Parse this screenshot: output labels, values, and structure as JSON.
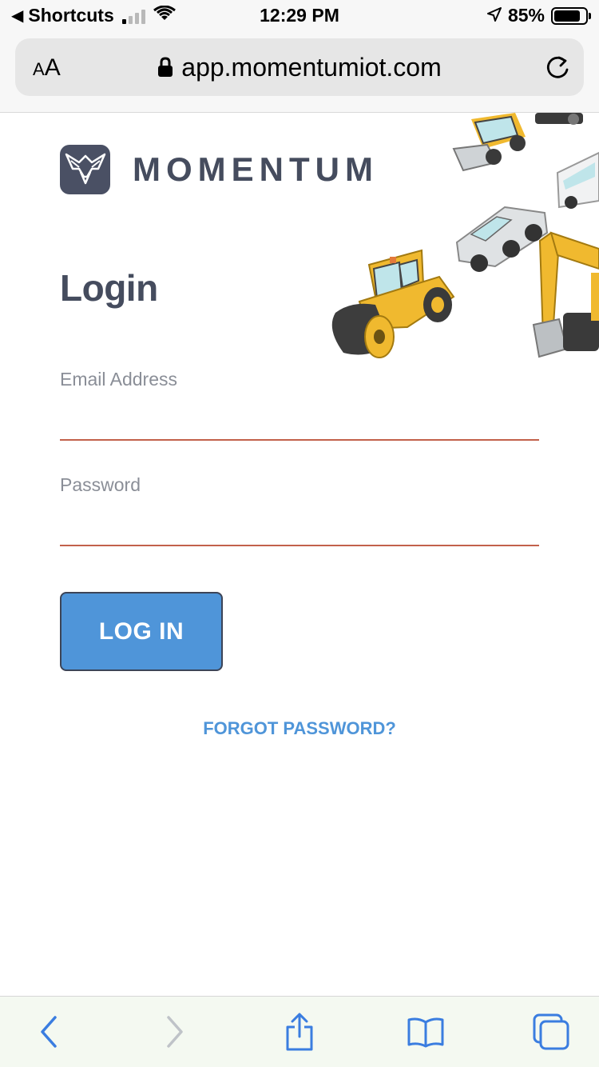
{
  "status_bar": {
    "back_app": "Shortcuts",
    "time": "12:29 PM",
    "battery": "85%",
    "battery_level": 0.85
  },
  "browser": {
    "text_size_label_small": "A",
    "text_size_label_large": "A",
    "url": "app.momentumiot.com"
  },
  "page": {
    "brand": "MOMENTUM",
    "title": "Login",
    "email_label": "Email Address",
    "email_value": "",
    "password_label": "Password",
    "password_value": "",
    "login_button": "LOG IN",
    "forgot_link": "FORGOT PASSWORD?"
  },
  "colors": {
    "brand_text": "#454c5e",
    "accent_blue": "#4f95d9",
    "input_underline": "#c2614b"
  },
  "icons": {
    "toolbar": [
      "back-icon",
      "forward-icon",
      "share-icon",
      "bookmarks-icon",
      "tabs-icon"
    ]
  }
}
